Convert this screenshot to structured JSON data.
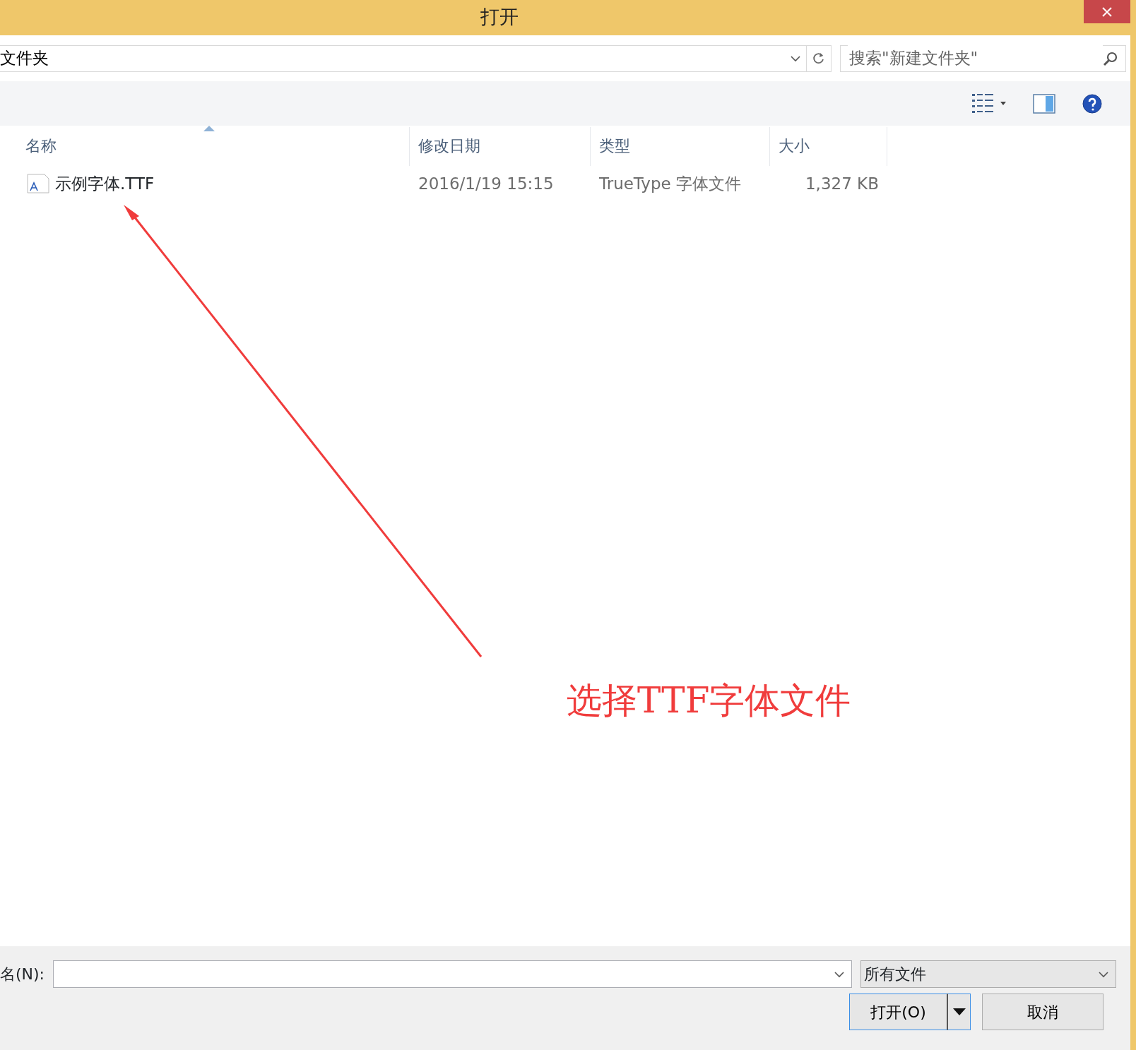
{
  "window": {
    "title": "打开"
  },
  "address": {
    "value": "文件夹"
  },
  "search": {
    "placeholder": "搜索\"新建文件夹\""
  },
  "columns": [
    {
      "label": "名称",
      "sorted": true
    },
    {
      "label": "修改日期",
      "sorted": false
    },
    {
      "label": "类型",
      "sorted": false
    },
    {
      "label": "大小",
      "sorted": false
    }
  ],
  "rows": [
    {
      "name": "示例字体.TTF",
      "date": "2016/1/19 15:15",
      "type": "TrueType 字体文件",
      "size": "1,327 KB"
    }
  ],
  "annotation": {
    "text": "选择TTF字体文件"
  },
  "filename": {
    "label": "名(N):"
  },
  "file_type": {
    "value": "所有文件"
  },
  "buttons": [
    {
      "label": "打开(O)",
      "kind": "split"
    },
    {
      "label": "取消",
      "kind": "plain"
    }
  ]
}
